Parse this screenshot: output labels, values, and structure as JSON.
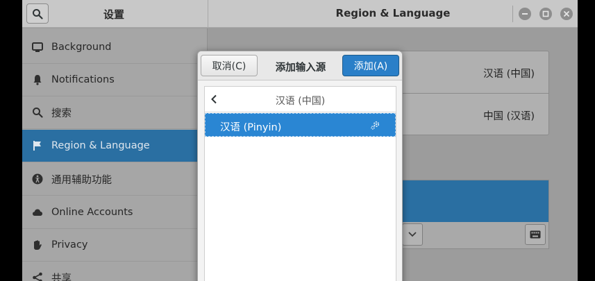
{
  "window": {
    "sidebar_title": "设置",
    "main_title": "Region & Language"
  },
  "sidebar": {
    "items": [
      {
        "label": "Background",
        "icon": "display-icon"
      },
      {
        "label": "Notifications",
        "icon": "bell-icon"
      },
      {
        "label": "搜索",
        "icon": "search-icon"
      },
      {
        "label": "Region & Language",
        "icon": "flag-icon",
        "active": true
      },
      {
        "label": "通用辅助功能",
        "icon": "accessibility-icon"
      },
      {
        "label": "Online Accounts",
        "icon": "cloud-icon"
      },
      {
        "label": "Privacy",
        "icon": "hand-icon"
      },
      {
        "label": "共享",
        "icon": "share-icon"
      }
    ]
  },
  "main": {
    "language_value": "汉语 (中国)",
    "formats_value": "中国 (汉语)"
  },
  "dialog": {
    "cancel_label": "取消(C)",
    "title": "添加输入源",
    "add_label": "添加(A)",
    "back_label": "汉语 (中国)",
    "items": [
      {
        "label": "汉语 (Pinyin)",
        "selected": true,
        "icon": "settings-gear-icon"
      }
    ]
  },
  "colors": {
    "accent": "#2a7fc8",
    "sidebar_active": "#2a6fa2"
  }
}
